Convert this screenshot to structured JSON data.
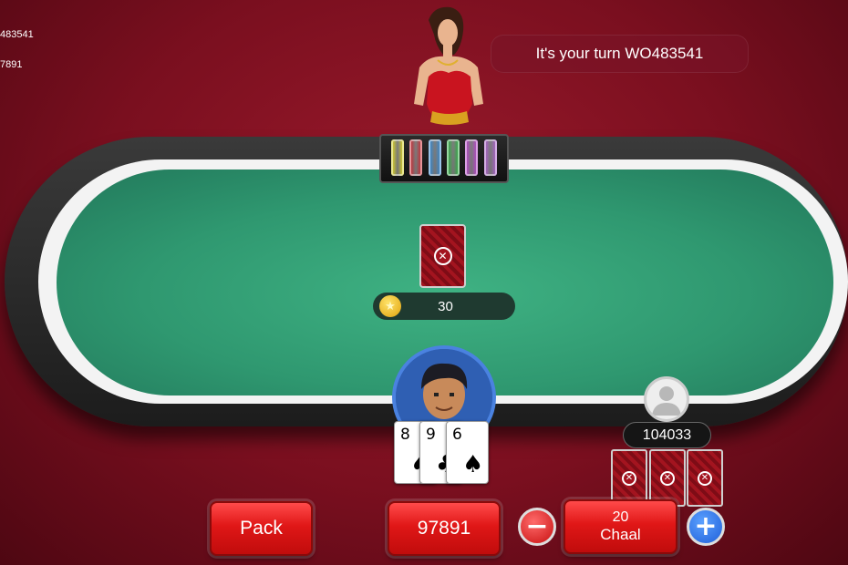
{
  "top_left": {
    "line1": "483541",
    "line2": "7891"
  },
  "turn_banner": "It's your turn WO483541",
  "pot": {
    "icon": "star-coin-icon",
    "value": "30"
  },
  "chip_tray": {
    "colors": [
      "#e8e017",
      "#d81f2a",
      "#2a8be0",
      "#22b83a",
      "#c23bd8",
      "#b35ad8"
    ]
  },
  "player": {
    "hand": [
      {
        "rank": "8",
        "suit": "♠"
      },
      {
        "rank": "9",
        "suit": "♣"
      },
      {
        "rank": "6",
        "suit": "♠"
      }
    ]
  },
  "opponent": {
    "chips": "104033",
    "card_count": 3
  },
  "controls": {
    "pack_label": "Pack",
    "balance": "97891",
    "chaal_amount": "20",
    "chaal_label": "Chaal",
    "decrease_symbol": "−",
    "increase_symbol": "+"
  },
  "colors": {
    "background": "#7a0f1f",
    "felt": "#2f9870",
    "button_red": "#e01717",
    "increase_blue": "#1f5fd8"
  }
}
